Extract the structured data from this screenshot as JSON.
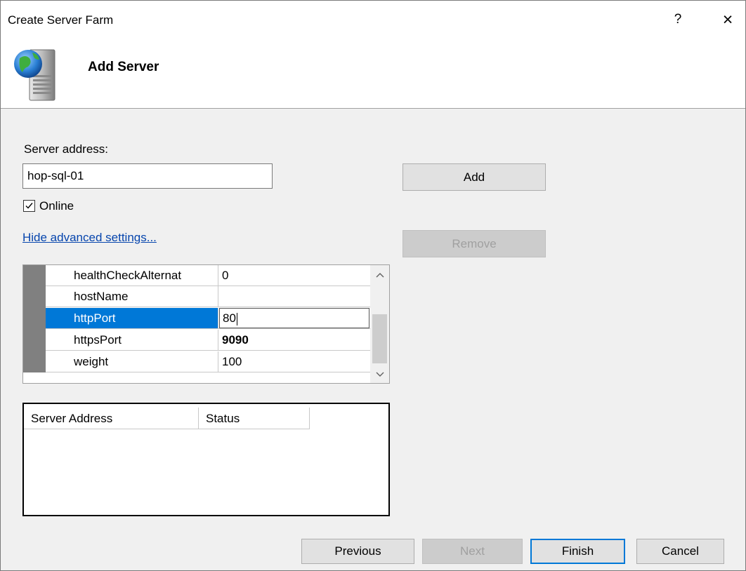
{
  "window": {
    "title": "Create Server Farm",
    "help_glyph": "?",
    "close_glyph": "×"
  },
  "header": {
    "title": "Add Server",
    "icon": "server-globe-icon"
  },
  "form": {
    "server_address_label": "Server address:",
    "server_address_value": "hop-sql-01",
    "online_checked": true,
    "online_label": "Online",
    "advanced_link": "Hide advanced settings..."
  },
  "buttons": {
    "add": "Add",
    "remove": "Remove"
  },
  "property_grid": {
    "rows": [
      {
        "name": "healthCheckAlternat",
        "value": "0"
      },
      {
        "name": "hostName",
        "value": ""
      },
      {
        "name": "httpPort",
        "value": "80",
        "selected": true
      },
      {
        "name": "httpsPort",
        "value": "9090",
        "bold": true
      },
      {
        "name": "weight",
        "value": "100"
      }
    ],
    "scroll_up": "^",
    "scroll_down": "v"
  },
  "server_list": {
    "columns": [
      "Server Address",
      "Status"
    ],
    "rows": []
  },
  "footer": {
    "previous": "Previous",
    "next": "Next",
    "finish": "Finish",
    "cancel": "Cancel"
  },
  "colors": {
    "selection": "#0078d7",
    "link": "#0645ad",
    "gutter": "#808080"
  }
}
